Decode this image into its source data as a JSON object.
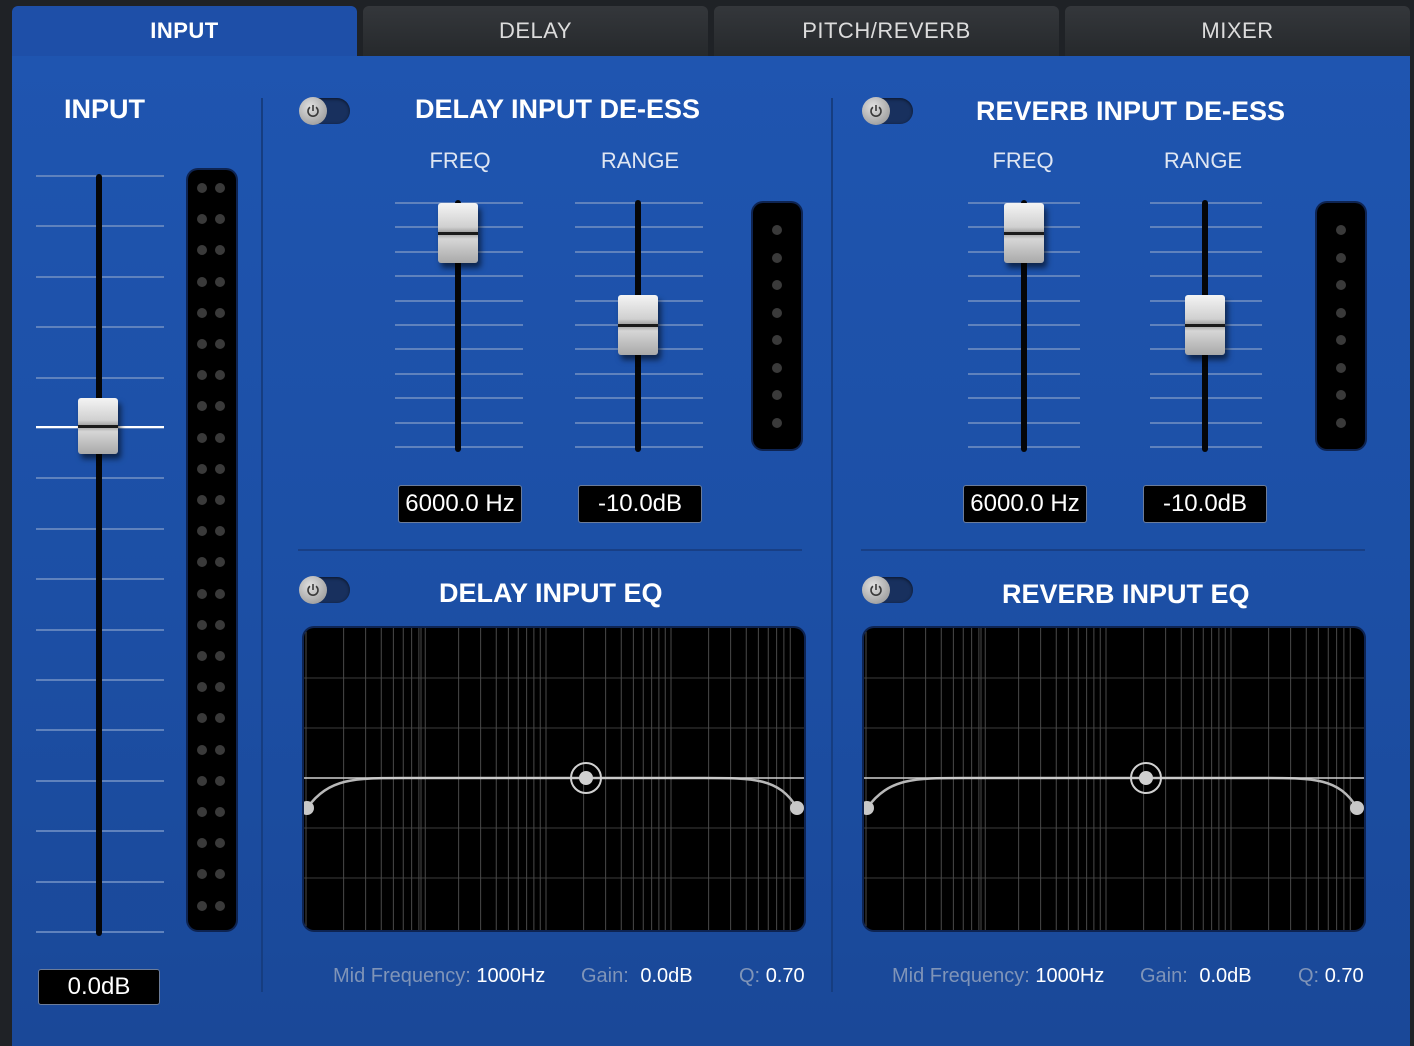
{
  "tabs": [
    {
      "label": "INPUT",
      "active": true
    },
    {
      "label": "DELAY",
      "active": false
    },
    {
      "label": "PITCH/REVERB",
      "active": false
    },
    {
      "label": "MIXER",
      "active": false
    }
  ],
  "colors": {
    "panel": "#1f55b0",
    "tab_inactive": "#2d3034",
    "track": "#050608",
    "readout_bg": "#000000"
  },
  "input": {
    "title": "INPUT",
    "fader_value": "0.0dB",
    "fader_level": 0.66
  },
  "delay_deess": {
    "title": "DELAY INPUT DE-ESS",
    "enabled": false,
    "freq_label": "FREQ",
    "range_label": "RANGE",
    "freq_value": "6000.0 Hz",
    "range_value": "-10.0dB",
    "freq_level": 0.88,
    "range_level": 0.5
  },
  "reverb_deess": {
    "title": "REVERB INPUT DE-ESS",
    "enabled": false,
    "freq_label": "FREQ",
    "range_label": "RANGE",
    "freq_value": "6000.0 Hz",
    "range_value": "-10.0dB",
    "freq_level": 0.88,
    "range_level": 0.5
  },
  "delay_eq": {
    "title": "DELAY INPUT EQ",
    "enabled": false,
    "mid_freq_label": "Mid Frequency:",
    "mid_freq_value": "1000Hz",
    "gain_label": "Gain:",
    "gain_value": "0.0dB",
    "q_label": "Q:",
    "q_value": "0.70"
  },
  "reverb_eq": {
    "title": "REVERB INPUT EQ",
    "enabled": false,
    "mid_freq_label": "Mid Frequency:",
    "mid_freq_value": "1000Hz",
    "gain_label": "Gain:",
    "gain_value": "0.0dB",
    "q_label": "Q:",
    "q_value": "0.70"
  },
  "icons": {
    "power": "power-icon"
  }
}
